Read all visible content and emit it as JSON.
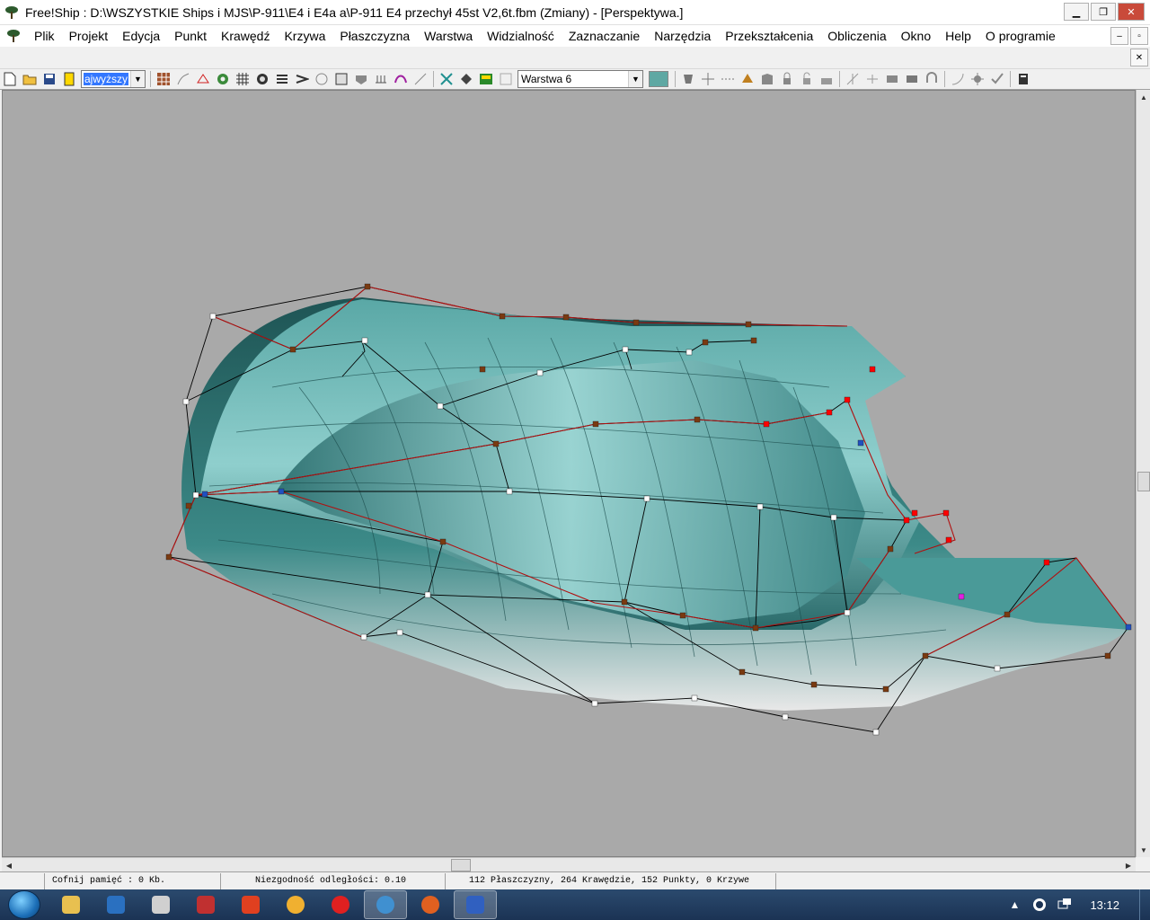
{
  "window": {
    "title": "Free!Ship  : D:\\WSZYSTKIE Ships i MJS\\P-911\\E4 i E4a a\\P-911 E4 przechył 45st V2,6t.fbm (Zmiany) - [Perspektywa.]",
    "minimize_label": "▁",
    "restore_label": "❐",
    "close_label": "✕"
  },
  "menu": {
    "items": [
      "Plik",
      "Projekt",
      "Edycja",
      "Punkt",
      "Krawędź",
      "Krzywa",
      "Płaszczyzna",
      "Warstwa",
      "Widzialność",
      "Zaznaczanie",
      "Narzędzia",
      "Przekształcenia",
      "Obliczenia",
      "Okno",
      "Help",
      "O programie"
    ],
    "mdi_minimize": "–",
    "mdi_restore": "▫",
    "mdi_close": "✕"
  },
  "toolbar": {
    "precision_value": "ajwyższy",
    "layer_value": "Warstwa 6",
    "layer_color": "#5fa8a3"
  },
  "statusbar": {
    "undo_memory": "Cofnij pamięć : 0 Kb.",
    "distance_tolerance": "Niezgodność odległości: 0.10",
    "model_info": "112 Płaszczyzny, 264 Krawędzie, 152 Punkty, 0 Krzywe"
  },
  "taskbar": {
    "clock": "13:12"
  },
  "colors": {
    "hull": "#3f8e8c",
    "viewport_bg": "#a9a9a9",
    "control_net": "#000000",
    "crease_edge": "#b01010",
    "point_regular": "#ffffff",
    "point_crease": "#7a3a10",
    "point_selected": "#ff0000"
  }
}
